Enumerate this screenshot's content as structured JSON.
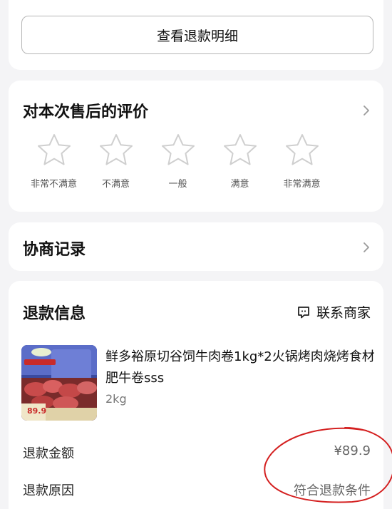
{
  "refund_detail_button": {
    "label": "查看退款明细"
  },
  "rating": {
    "title": "对本次售后的评价",
    "options": [
      {
        "label": "非常不满意",
        "icon": "star-outline-icon"
      },
      {
        "label": "不满意",
        "icon": "star-outline-icon"
      },
      {
        "label": "一般",
        "icon": "star-outline-icon"
      },
      {
        "label": "满意",
        "icon": "star-outline-icon"
      },
      {
        "label": "非常满意",
        "icon": "star-outline-icon"
      }
    ]
  },
  "negotiation": {
    "title": "协商记录"
  },
  "refund_info": {
    "title": "退款信息",
    "contact_label": "联系商家",
    "product": {
      "title": "鲜多裕原切谷饲牛肉卷1kg*2火锅烤肉烧烤食材肥牛卷sss",
      "spec": "2kg",
      "image_price_tag": "89.9"
    },
    "rows": [
      {
        "label": "退款金额",
        "value": "¥89.9"
      },
      {
        "label": "退款原因",
        "value": "符合退款条件"
      }
    ]
  },
  "colors": {
    "background": "#f4f4f6",
    "card": "#ffffff",
    "annotation": "#d42020",
    "star_outline": "#cfcfcf"
  }
}
